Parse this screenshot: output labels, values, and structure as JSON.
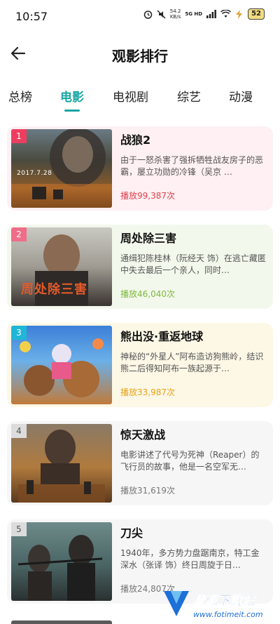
{
  "status": {
    "time": "10:57",
    "speed_value": "54.2",
    "speed_unit": "KB/s",
    "network": "5G HD",
    "battery": "52"
  },
  "header": {
    "title": "观影排行"
  },
  "tabs": [
    {
      "label": "总榜"
    },
    {
      "label": "电影"
    },
    {
      "label": "电视剧"
    },
    {
      "label": "综艺"
    },
    {
      "label": "动漫"
    }
  ],
  "active_tab": "电影",
  "movies": [
    {
      "rank": "1",
      "title": "战狼2",
      "desc": "由于一怒杀害了强拆牺牲战友房子的恶霸，屡立功勋的冷锋（吴京 …",
      "plays": "播放99,387次",
      "poster_text": "2017.7.28",
      "rank_color": "#ec3f60",
      "plays_color": "#e0424d",
      "card_bg": "#fef0f3"
    },
    {
      "rank": "2",
      "title": "周处除三害",
      "desc": "通缉犯陈桂林（阮经天 饰）在逃亡藏匿中失去最后一个亲人，同时…",
      "plays": "播放46,040次",
      "poster_text": "周处除三害",
      "rank_color": "#ef6d88",
      "plays_color": "#7dba3d",
      "card_bg": "#f3f8ec"
    },
    {
      "rank": "3",
      "title": "熊出没·重返地球",
      "desc": "神秘的“外星人”阿布造访狗熊岭，结识熊二后得知阿布一族起源于…",
      "plays": "播放33,987次",
      "poster_text": "",
      "rank_color": "#20b6d8",
      "plays_color": "#e5a419",
      "card_bg": "#fdf7e6"
    },
    {
      "rank": "4",
      "title": "惊天激战",
      "desc": "电影讲述了代号为死神（Reaper）的飞行员的故事，他是一名空军无…",
      "plays": "播放31,619次",
      "poster_text": "",
      "rank_color": "#dcdcdc",
      "plays_color": "#777777",
      "card_bg": "#f6f6f6"
    },
    {
      "rank": "5",
      "title": "刀尖",
      "desc": "1940年，多方势力盘踞南京，特工金深水（张译 饰）终日周旋于日…",
      "plays": "播放24,807次",
      "poster_text": "",
      "rank_color": "#dcdcdc",
      "plays_color": "#777777",
      "card_bg": "#f6f6f6"
    }
  ],
  "watermark": {
    "text": "清源下载站",
    "url": "www.fotimeit.com"
  }
}
